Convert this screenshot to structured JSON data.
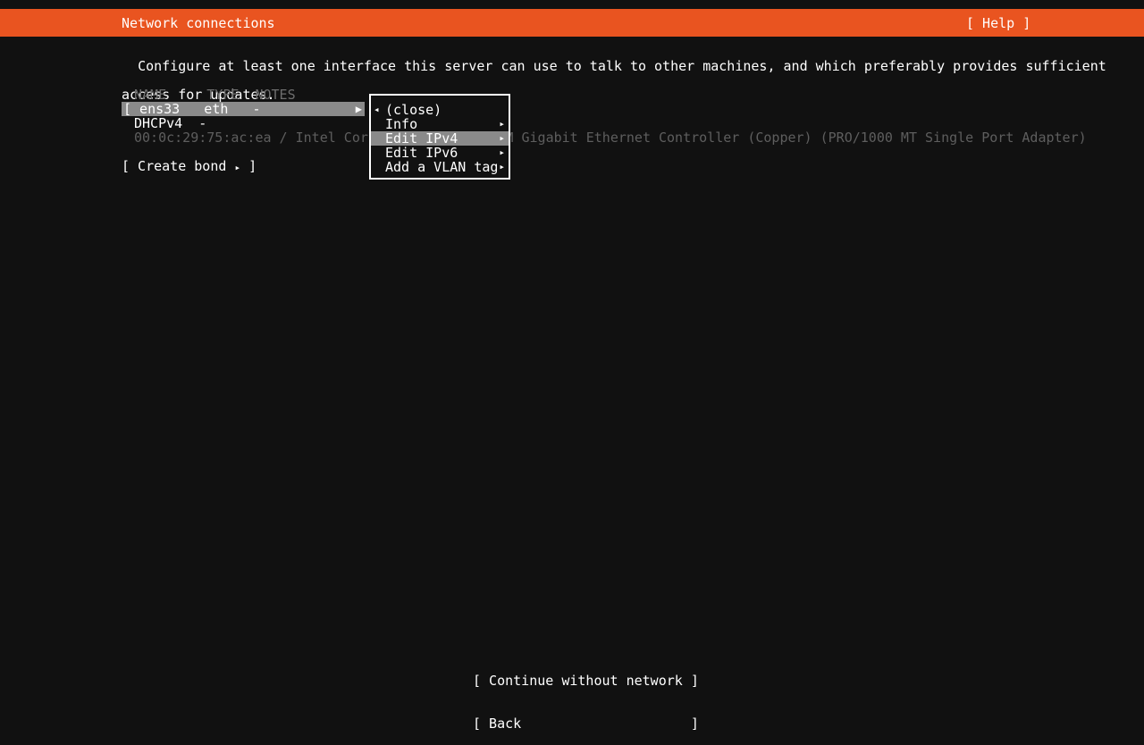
{
  "header": {
    "title": "Network connections",
    "help_label": "[ Help ]"
  },
  "intro": {
    "line1": "Configure at least one interface this server can use to talk to other machines, and which preferably provides sufficient",
    "line2": "access for updates."
  },
  "table": {
    "columns": "NAME     TYPE  NOTES",
    "rows": [
      {
        "bracket": "[ ens33   eth   -",
        "name": "ens33",
        "type": "eth",
        "notes": "-",
        "caret": "▶",
        "selected": true,
        "detail_line": "DHCPv4  -",
        "hardware": "00:0c:29:75:ac:ea / Intel Corporation / 82545EM Gigabit Ethernet Controller (Copper) (PRO/1000 MT Single Port Adapter)"
      }
    ]
  },
  "create_bond": {
    "prefix": "[ Create bond ",
    "arrow": "▸",
    "suffix": " ]"
  },
  "menu": {
    "items": [
      {
        "label": "(close)",
        "arrow_left": "◂",
        "arrow_right": "",
        "selected": false
      },
      {
        "label": "Info",
        "arrow_left": "",
        "arrow_right": "▸",
        "selected": false
      },
      {
        "label": "Edit IPv4",
        "arrow_left": "",
        "arrow_right": "▸",
        "selected": true
      },
      {
        "label": "Edit IPv6",
        "arrow_left": "",
        "arrow_right": "▸",
        "selected": false
      },
      {
        "label": "Add a VLAN tag",
        "arrow_left": "",
        "arrow_right": "▸",
        "selected": false
      }
    ]
  },
  "footer": {
    "continue_label": "[ Continue without network ]",
    "back_label": "[ Back                     ]"
  },
  "colors": {
    "accent": "#e95420",
    "background": "#111111",
    "highlight": "#8a8a8a",
    "dim_text": "#6e6e6e"
  }
}
